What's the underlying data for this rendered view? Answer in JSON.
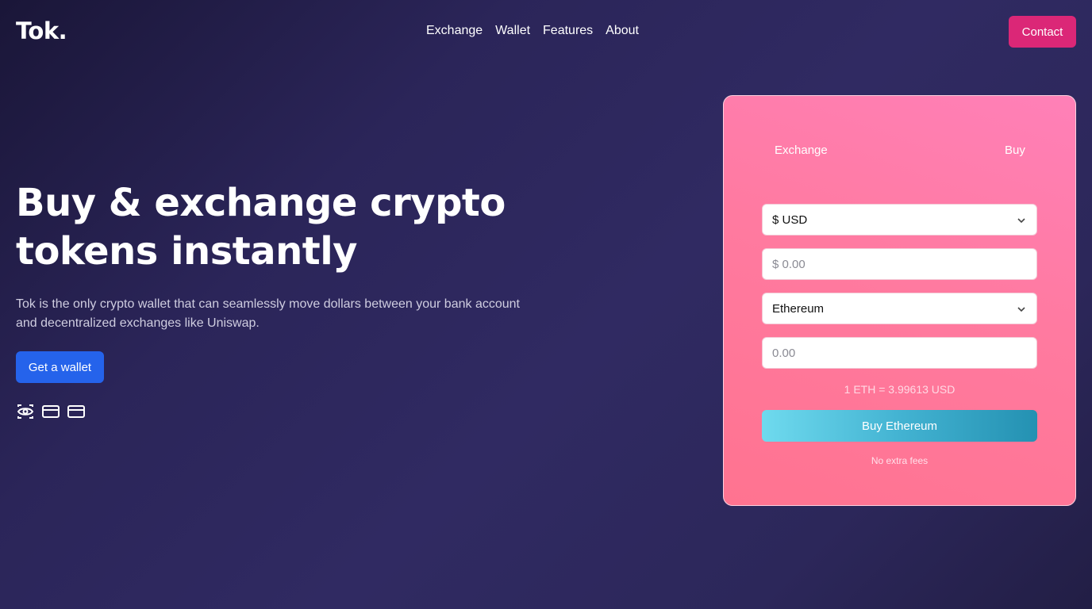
{
  "header": {
    "logo": "Tok.",
    "nav": [
      "Exchange",
      "Wallet",
      "Features",
      "About"
    ],
    "contact_label": "Contact"
  },
  "hero": {
    "title_line1": "Buy & exchange crypto",
    "title_line2": "tokens instantly",
    "description": "Tok is the only crypto wallet that can seamlessly move dollars between your bank account and decentralized exchanges like Uniswap.",
    "cta_label": "Get a wallet",
    "icons": [
      "eye-icon",
      "credit-card-icon",
      "credit-card-icon"
    ]
  },
  "widget": {
    "tabs": [
      "Exchange",
      "Buy"
    ],
    "currency_select": "$ USD",
    "amount_placeholder": "$ 0.00",
    "token_select": "Ethereum",
    "token_amount_placeholder": "0.00",
    "rate": "1 ETH = 3.99613 USD",
    "buy_label": "Buy Ethereum",
    "fees_note": "No extra fees"
  },
  "colors": {
    "contact": "#db2777",
    "cta": "#2563eb",
    "card": "#ff7aa0",
    "buy_button": "#43b3d2"
  }
}
